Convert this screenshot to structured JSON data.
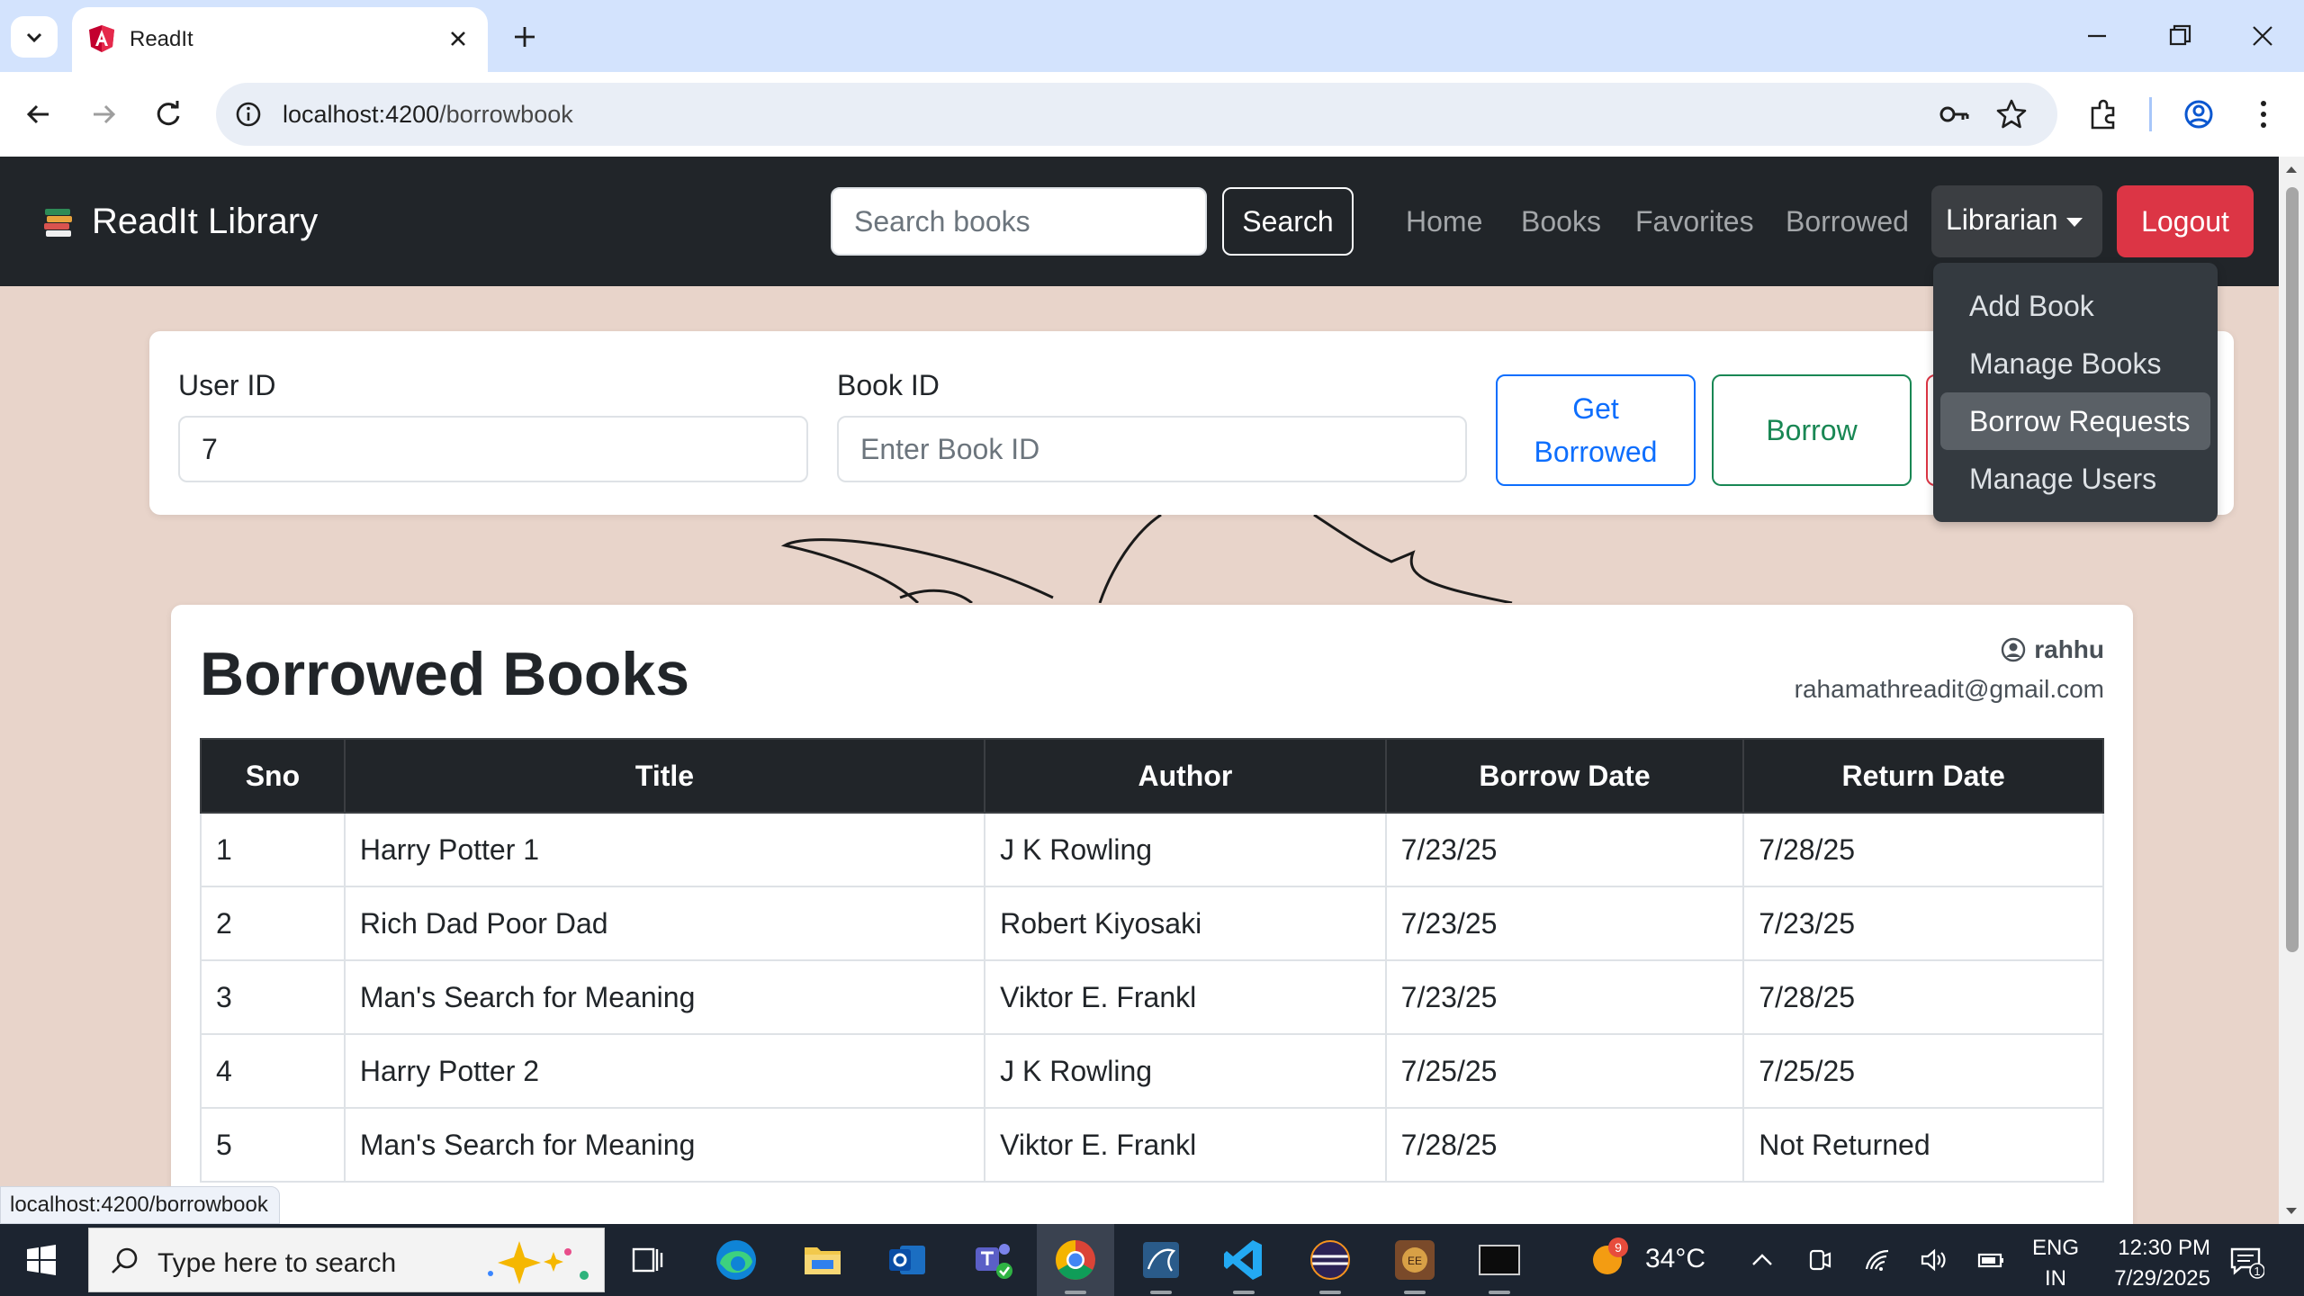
{
  "browser": {
    "tab_title": "ReadIt",
    "url_host": "localhost:4200",
    "url_path": "/borrowbook",
    "status_url": "localhost:4200/borrowbook"
  },
  "navbar": {
    "brand": "ReadIt Library",
    "search_placeholder": "Search books",
    "search_button": "Search",
    "links": [
      "Home",
      "Books",
      "Favorites",
      "Borrowed"
    ],
    "librarian_label": "Librarian",
    "logout_label": "Logout",
    "dropdown_items": [
      "Add Book",
      "Manage Books",
      "Borrow Requests",
      "Manage Users"
    ],
    "active_dropdown_item": "Borrow Requests"
  },
  "form": {
    "user_id_label": "User ID",
    "user_id_value": "7",
    "book_id_label": "Book ID",
    "book_id_placeholder": "Enter Book ID",
    "get_borrowed_label": "Get Borrowed",
    "borrow_label": "Borrow"
  },
  "borrowed": {
    "title": "Borrowed Books",
    "username": "rahhu",
    "email": "rahamathreadit@gmail.com",
    "columns": [
      "Sno",
      "Title",
      "Author",
      "Borrow Date",
      "Return Date"
    ],
    "rows": [
      [
        "1",
        "Harry Potter 1",
        "J K Rowling",
        "7/23/25",
        "7/28/25"
      ],
      [
        "2",
        "Rich Dad Poor Dad",
        "Robert Kiyosaki",
        "7/23/25",
        "7/23/25"
      ],
      [
        "3",
        "Man's Search for Meaning",
        "Viktor E. Frankl",
        "7/23/25",
        "7/28/25"
      ],
      [
        "4",
        "Harry Potter 2",
        "J K Rowling",
        "7/25/25",
        "7/25/25"
      ],
      [
        "5",
        "Man's Search for Meaning",
        "Viktor E. Frankl",
        "7/28/25",
        "Not Returned"
      ]
    ]
  },
  "taskbar": {
    "search_text": "Type here to search",
    "weather_badge": "9",
    "temperature": "34°C",
    "lang_1": "ENG",
    "lang_2": "IN",
    "time": "12:30 PM",
    "date": "7/29/2025",
    "notification_count": "1"
  },
  "colors": {
    "page_bg": "#e8d4ca",
    "navbar_bg": "#212529",
    "primary": "#0d6efd",
    "success": "#198754",
    "danger": "#dc3545",
    "chrome_tabstrip": "#d3e3fd"
  }
}
